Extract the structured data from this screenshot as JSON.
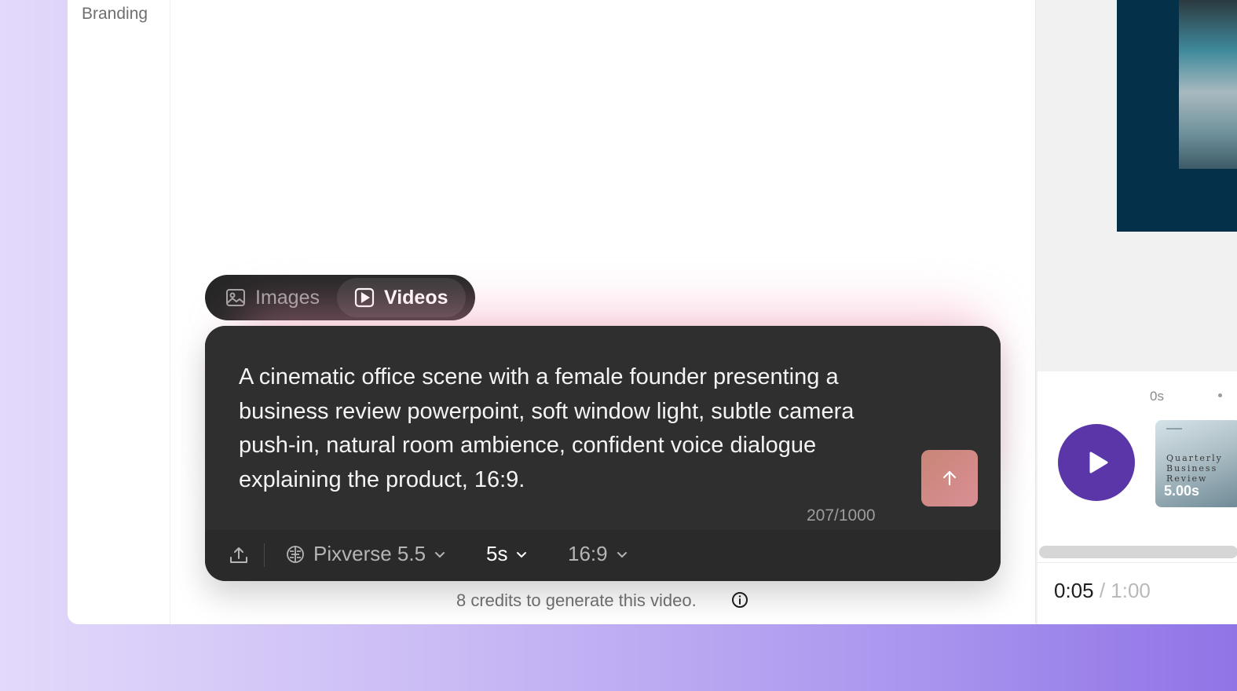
{
  "sidebar": {
    "items": [
      {
        "label": "Branding"
      }
    ]
  },
  "mode_toggle": {
    "tabs": [
      {
        "label": "Images",
        "icon": "image-icon",
        "active": false
      },
      {
        "label": "Videos",
        "icon": "video-icon",
        "active": true
      }
    ]
  },
  "composer": {
    "prompt": "A cinematic office scene with a female founder presenting a business review powerpoint, soft window light, subtle camera push-in, natural room ambience, confident voice dialogue explaining the product, 16:9.",
    "char_count": "207/1000",
    "send_icon": "arrow-up-icon",
    "toolbar": {
      "upload_icon": "upload-icon",
      "model_icon": "brain-icon",
      "model": "Pixverse 5.5",
      "duration": "5s",
      "aspect_ratio": "16:9"
    },
    "credits_note": "8 credits to generate this video.",
    "info_icon": "info-icon"
  },
  "timeline": {
    "ruler_label": "0s",
    "clip": {
      "title": "Quarterly Business Review",
      "duration": "5.00s"
    },
    "time_current": "0:05",
    "time_separator": " / ",
    "time_total": "1:00"
  },
  "colors": {
    "accent_play": "#5b36a8",
    "send_button": "#d08a85",
    "composer_bg": "#2c2c2c",
    "preview_bg": "#04304a"
  }
}
